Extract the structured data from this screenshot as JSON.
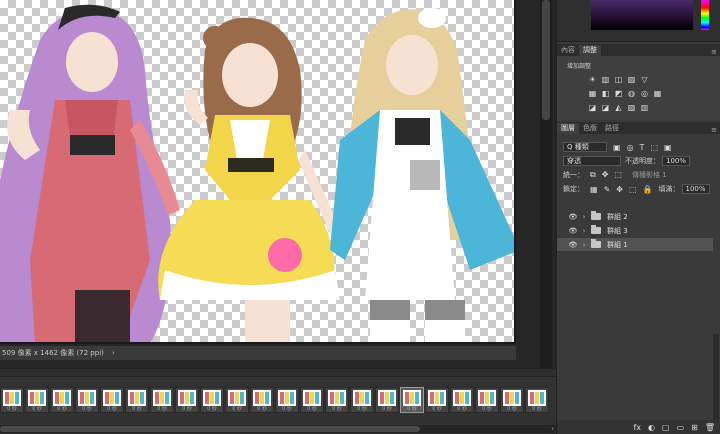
{
  "status": {
    "doc_info": "509 像素 x 1462 像素 (72 ppi)",
    "arrow": "›"
  },
  "timeline": {
    "frames": [
      "0 秒",
      "0 秒",
      "0 秒",
      "0 秒",
      "0 秒",
      "0 秒",
      "0 秒",
      "0 秒",
      "0 秒",
      "0 秒",
      "0 秒",
      "0 秒",
      "0 秒",
      "0 秒",
      "0 秒",
      "0 秒",
      "0 秒",
      "0 秒",
      "0 秒",
      "0 秒",
      "0 秒",
      "0 秒"
    ],
    "active_frame_index": 16,
    "right_arrow": "›"
  },
  "adjustments": {
    "tabs": [
      "內容",
      "調整"
    ],
    "active_tab": "調整",
    "title": "增加調整",
    "row1": [
      "☀",
      "▥",
      "◫",
      "▨",
      "▽"
    ],
    "row2": [
      "▦",
      "◧",
      "◩",
      "◍",
      "◎",
      "▦"
    ],
    "row3": [
      "◪",
      "◪",
      "◭",
      "▨",
      "▥"
    ]
  },
  "layers": {
    "tabs": [
      "圖層",
      "色版",
      "路徑"
    ],
    "active_tab": "圖層",
    "filter_kind": "Q 種類",
    "filter_icons": [
      "▣",
      "◎",
      "T",
      "⬚",
      "▣"
    ],
    "blend_mode": "穿透",
    "opacity_label": "不透明度：",
    "opacity_value": "100%",
    "unify_label": "統一：",
    "unify_icons": [
      "⧉",
      "✥",
      "⬚"
    ],
    "propagate_label": "傳播影格 1",
    "lock_label": "鎖定：",
    "lock_icons": [
      "▦",
      "✎",
      "✥",
      "⬚",
      "🔒"
    ],
    "fill_label": "填滿：",
    "fill_value": "100%",
    "items": [
      {
        "name": "群組 2",
        "selected": false
      },
      {
        "name": "群組 3",
        "selected": false
      },
      {
        "name": "群組 1",
        "selected": true
      }
    ],
    "footer_icons": [
      "fx",
      "◐",
      "▢",
      "▭",
      "⊞",
      "🗑"
    ]
  },
  "colors": {
    "accent": "#535353",
    "panel": "#3a3a3a"
  }
}
